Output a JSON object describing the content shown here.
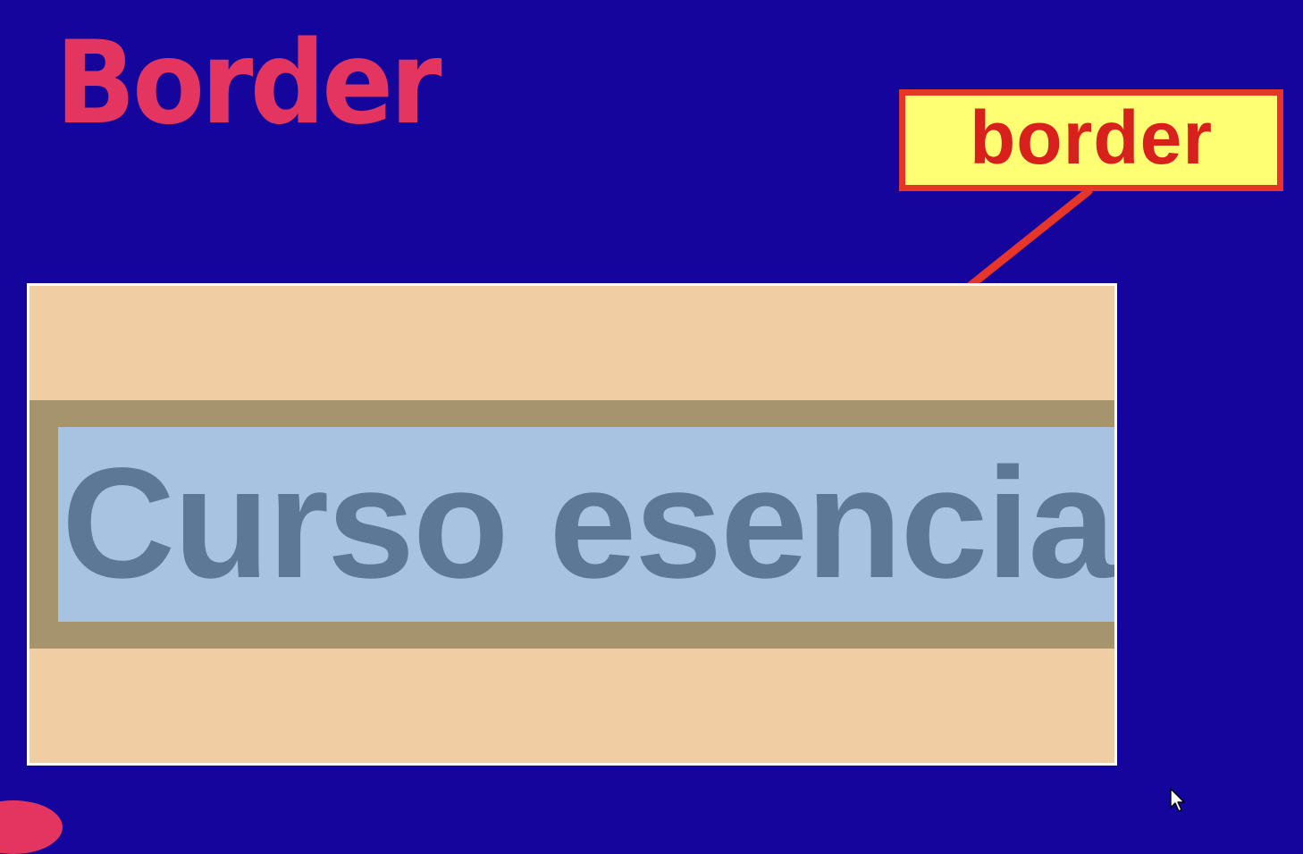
{
  "slide": {
    "title": "Border",
    "callout_label": "border"
  },
  "demo": {
    "text": "Curso esencial"
  },
  "colors": {
    "background": "#14069c",
    "title": "#e33560",
    "callout_fill": "#ffff73",
    "callout_border": "#e8352a",
    "arrow": "#e8352a",
    "margin_area": "#f0cda2",
    "border_area": "#a6956c",
    "content_area": "#a8c3e2",
    "content_text": "#5d7897"
  },
  "icons": {
    "cursor": "mouse-pointer-icon",
    "arrow": "arrow-pointer-icon"
  }
}
